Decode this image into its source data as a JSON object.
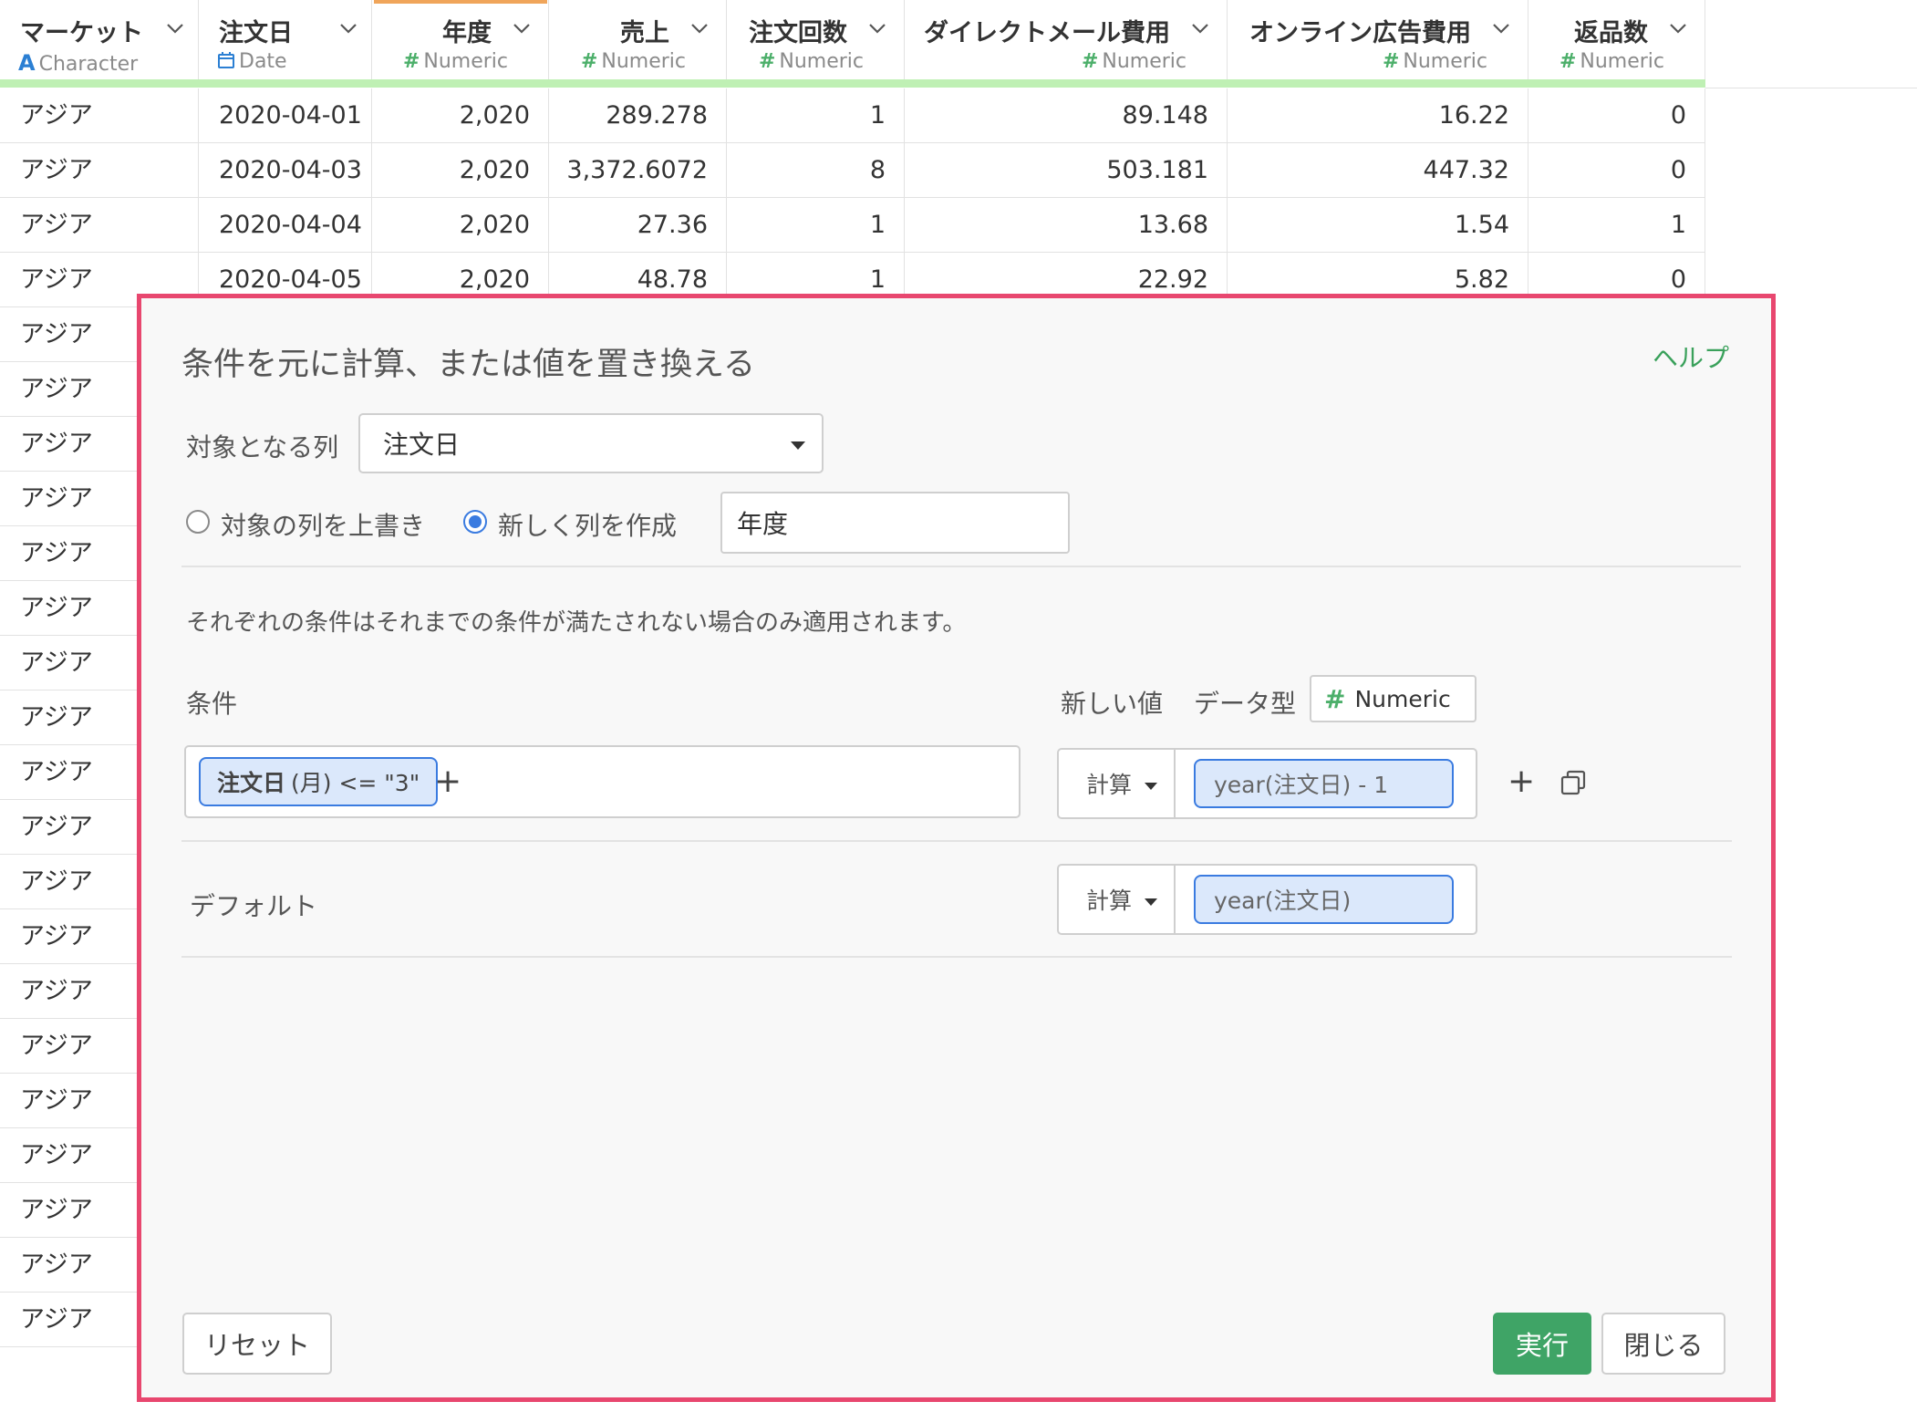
{
  "table": {
    "columns": [
      {
        "name": "マーケット",
        "type_icon": "A",
        "type": "Character",
        "type_kind": "char"
      },
      {
        "name": "注文日",
        "type_icon": "calendar-icon",
        "type": "Date",
        "type_kind": "date"
      },
      {
        "name": "年度",
        "type_icon": "#",
        "type": "Numeric",
        "type_kind": "num"
      },
      {
        "name": "売上",
        "type_icon": "#",
        "type": "Numeric",
        "type_kind": "num"
      },
      {
        "name": "注文回数",
        "type_icon": "#",
        "type": "Numeric",
        "type_kind": "num"
      },
      {
        "name": "ダイレクトメール費用",
        "type_icon": "#",
        "type": "Numeric",
        "type_kind": "num"
      },
      {
        "name": "オンライン広告費用",
        "type_icon": "#",
        "type": "Numeric",
        "type_kind": "num"
      },
      {
        "name": "返品数",
        "type_icon": "#",
        "type": "Numeric",
        "type_kind": "num"
      }
    ],
    "rows": [
      [
        "アジア",
        "2020-04-01",
        "2,020",
        "289.278",
        "1",
        "89.148",
        "16.22",
        "0"
      ],
      [
        "アジア",
        "2020-04-03",
        "2,020",
        "3,372.6072",
        "8",
        "503.181",
        "447.32",
        "0"
      ],
      [
        "アジア",
        "2020-04-04",
        "2,020",
        "27.36",
        "1",
        "13.68",
        "1.54",
        "1"
      ],
      [
        "アジア",
        "2020-04-05",
        "2,020",
        "48.78",
        "1",
        "22.92",
        "5.82",
        "0"
      ]
    ],
    "market_column_more": [
      "アジア",
      "アジア",
      "アジア",
      "アジア",
      "アジア",
      "アジア",
      "アジア",
      "アジア",
      "アジア",
      "アジア",
      "アジア",
      "アジア",
      "アジア",
      "アジア",
      "アジア",
      "アジア",
      "アジア",
      "アジア",
      "アジア"
    ]
  },
  "dialog": {
    "title": "条件を元に計算、または値を置き換える",
    "help": "ヘルプ",
    "target_label": "対象となる列",
    "target_value": "注文日",
    "radio_overwrite": "対象の列を上書き",
    "radio_new": "新しく列を作成",
    "new_column_name": "年度",
    "note": "それぞれの条件はそれまでの条件が満たされない場合のみ適用されます。",
    "condition_header": "条件",
    "new_value_header": "新しい値",
    "data_type_header": "データ型",
    "data_type_value": "Numeric",
    "condition_chip": {
      "column": "注文日",
      "rest": "(月) <= \"3\""
    },
    "calc_label": "計算",
    "formula_1": "year(注文日) - 1",
    "default_label": "デフォルト",
    "formula_default": "year(注文日)",
    "reset": "リセット",
    "run": "実行",
    "close": "閉じる"
  },
  "colors": {
    "accent_green": "#3fa466",
    "dialog_border": "#e8476f",
    "chip_blue": "#3a7be0"
  }
}
